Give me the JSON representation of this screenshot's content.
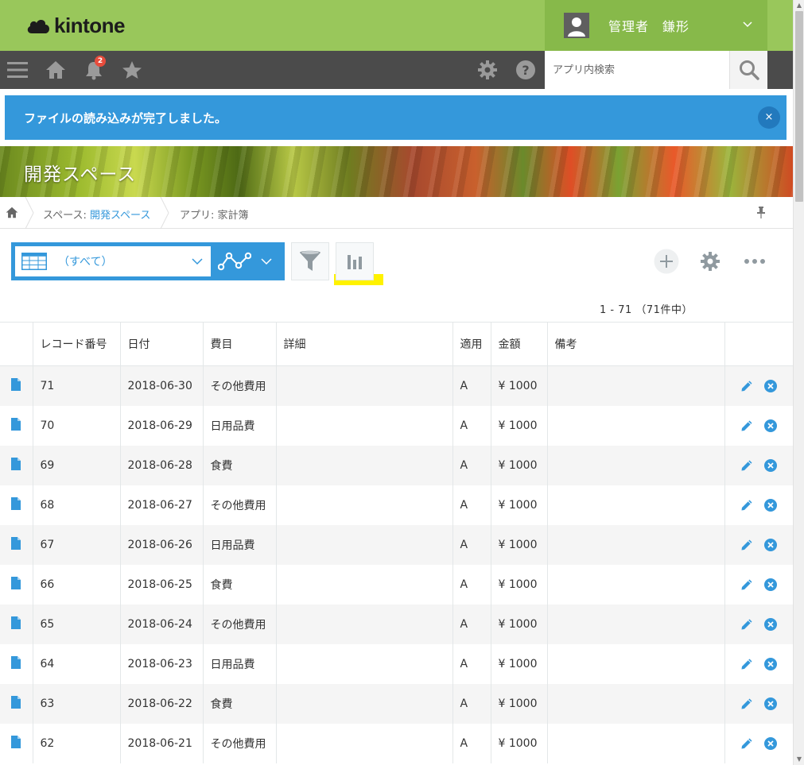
{
  "header": {
    "logo_text": "kintone",
    "user_name": "管理者　鎌形"
  },
  "nav": {
    "notification_count": "2",
    "search_placeholder": "アプリ内検索"
  },
  "notification": {
    "message": "ファイルの読み込みが完了しました。",
    "close_label": "×"
  },
  "space": {
    "title": "開発スペース"
  },
  "breadcrumb": {
    "space_prefix": "スペース: ",
    "space_name": "開発スペース",
    "app_label": "アプリ: 家計簿"
  },
  "toolbar": {
    "view_label": "（すべて）",
    "record_count": "1 - 71  （71件中）"
  },
  "colors": {
    "header_green": "#99c75b",
    "accent_blue": "#3498db",
    "nav_dark": "#4b4b4b",
    "highlight_yellow": "#fff200"
  },
  "table": {
    "headers": [
      "レコード番号",
      "日付",
      "費目",
      "詳細",
      "適用",
      "金額",
      "備考"
    ],
    "rows": [
      {
        "id": "71",
        "date": "2018-06-30",
        "category": "その他費用",
        "detail": "",
        "apply": "A",
        "amount": "¥ 1000",
        "note": ""
      },
      {
        "id": "70",
        "date": "2018-06-29",
        "category": "日用品費",
        "detail": "",
        "apply": "A",
        "amount": "¥ 1000",
        "note": ""
      },
      {
        "id": "69",
        "date": "2018-06-28",
        "category": "食費",
        "detail": "",
        "apply": "A",
        "amount": "¥ 1000",
        "note": ""
      },
      {
        "id": "68",
        "date": "2018-06-27",
        "category": "その他費用",
        "detail": "",
        "apply": "A",
        "amount": "¥ 1000",
        "note": ""
      },
      {
        "id": "67",
        "date": "2018-06-26",
        "category": "日用品費",
        "detail": "",
        "apply": "A",
        "amount": "¥ 1000",
        "note": ""
      },
      {
        "id": "66",
        "date": "2018-06-25",
        "category": "食費",
        "detail": "",
        "apply": "A",
        "amount": "¥ 1000",
        "note": ""
      },
      {
        "id": "65",
        "date": "2018-06-24",
        "category": "その他費用",
        "detail": "",
        "apply": "A",
        "amount": "¥ 1000",
        "note": ""
      },
      {
        "id": "64",
        "date": "2018-06-23",
        "category": "日用品費",
        "detail": "",
        "apply": "A",
        "amount": "¥ 1000",
        "note": ""
      },
      {
        "id": "63",
        "date": "2018-06-22",
        "category": "食費",
        "detail": "",
        "apply": "A",
        "amount": "¥ 1000",
        "note": ""
      },
      {
        "id": "62",
        "date": "2018-06-21",
        "category": "その他費用",
        "detail": "",
        "apply": "A",
        "amount": "¥ 1000",
        "note": ""
      }
    ]
  }
}
